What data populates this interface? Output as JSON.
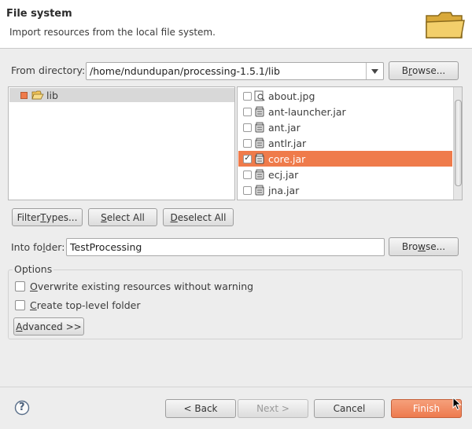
{
  "header": {
    "title": "File system",
    "description": "Import resources from the local file system."
  },
  "from_directory": {
    "label_pre": "From directory:",
    "value": "/home/ndundupan/processing-1.5.1/lib",
    "browse_pre": "B",
    "browse_u": "r",
    "browse_post": "owse..."
  },
  "tree": {
    "items": [
      {
        "label": "lib",
        "checked_state": "partial"
      }
    ]
  },
  "files": {
    "items": [
      {
        "name": "about.jpg",
        "checked": false,
        "icon": "image-file-icon"
      },
      {
        "name": "ant-launcher.jar",
        "checked": false,
        "icon": "jar-file-icon"
      },
      {
        "name": "ant.jar",
        "checked": false,
        "icon": "jar-file-icon"
      },
      {
        "name": "antlr.jar",
        "checked": false,
        "icon": "jar-file-icon"
      },
      {
        "name": "core.jar",
        "checked": true,
        "selected": true,
        "icon": "jar-file-icon"
      },
      {
        "name": "ecj.jar",
        "checked": false,
        "icon": "jar-file-icon"
      },
      {
        "name": "jna.jar",
        "checked": false,
        "icon": "jar-file-icon"
      }
    ],
    "check_mark": "✓"
  },
  "selection_buttons": {
    "filter_pre": "Filter ",
    "filter_u": "T",
    "filter_post": "ypes...",
    "select_all_u": "S",
    "select_all_post": "elect All",
    "deselect_all_u": "D",
    "deselect_all_post": "eselect All"
  },
  "into_folder": {
    "label_pre": "Into fo",
    "label_u": "l",
    "label_post": "der:",
    "value": "TestProcessing",
    "browse_pre": "Bro",
    "browse_u": "w",
    "browse_post": "se..."
  },
  "options": {
    "legend": "Options",
    "overwrite_u": "O",
    "overwrite_post": "verwrite existing resources without warning",
    "create_u": "C",
    "create_post": "reate top-level folder",
    "advanced_u": "A",
    "advanced_post": "dvanced >>"
  },
  "footer": {
    "back": "< Back",
    "next": "Next >",
    "cancel": "Cancel",
    "finish": "Finish",
    "help_glyph": "?"
  },
  "colors": {
    "selection": "#ef7b4b",
    "finish": "#ed7a4e"
  }
}
